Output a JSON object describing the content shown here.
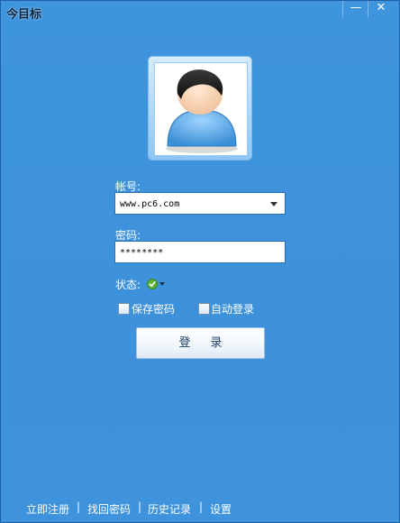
{
  "window": {
    "title": "今目标",
    "minimize_glyph": "—",
    "close_glyph": "✕"
  },
  "form": {
    "account_label": "帐号:",
    "account_value": "www.pc6.com",
    "password_label": "密码:",
    "password_value": "********",
    "status_label": "状态:",
    "status_icon": "online-check-icon"
  },
  "options": {
    "save_password": "保存密码",
    "auto_login": "自动登录"
  },
  "login_button": "登录",
  "footer": {
    "register": "立即注册",
    "recover": "找回密码",
    "history": "历史记录",
    "settings": "设置",
    "separator": "|"
  },
  "colors": {
    "background": "#3e93dc",
    "status_green": "#4aa82a"
  }
}
